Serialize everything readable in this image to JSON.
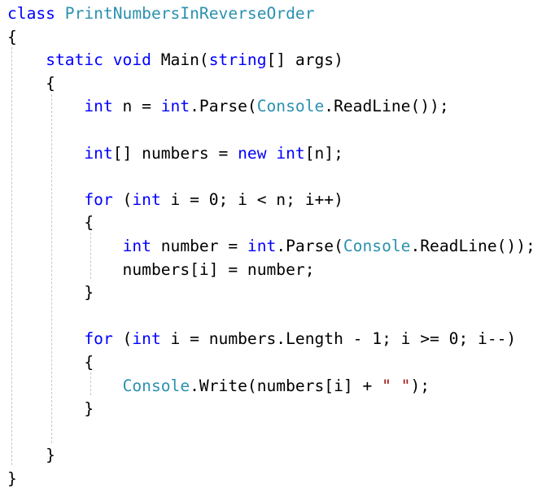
{
  "editor": {
    "colors": {
      "keyword": "#0000ff",
      "type": "#2b91af",
      "string": "#a31515",
      "plain": "#000000",
      "indent_guide": "#c8c8c8",
      "background": "#ffffff"
    },
    "lines": [
      [
        {
          "t": "class",
          "c": "kw"
        },
        {
          "t": " ",
          "c": "pl"
        },
        {
          "t": "PrintNumbersInReverseOrder",
          "c": "ty"
        }
      ],
      [
        {
          "t": "{",
          "c": "pl"
        }
      ],
      [
        {
          "t": "    ",
          "c": "pl"
        },
        {
          "t": "static",
          "c": "kw"
        },
        {
          "t": " ",
          "c": "pl"
        },
        {
          "t": "void",
          "c": "kw"
        },
        {
          "t": " Main(",
          "c": "pl"
        },
        {
          "t": "string",
          "c": "kw"
        },
        {
          "t": "[] args)",
          "c": "pl"
        }
      ],
      [
        {
          "t": "    {",
          "c": "pl"
        }
      ],
      [
        {
          "t": "        ",
          "c": "pl"
        },
        {
          "t": "int",
          "c": "kw"
        },
        {
          "t": " n = ",
          "c": "pl"
        },
        {
          "t": "int",
          "c": "kw"
        },
        {
          "t": ".Parse(",
          "c": "pl"
        },
        {
          "t": "Console",
          "c": "ty"
        },
        {
          "t": ".ReadLine());",
          "c": "pl"
        }
      ],
      [],
      [
        {
          "t": "        ",
          "c": "pl"
        },
        {
          "t": "int",
          "c": "kw"
        },
        {
          "t": "[] numbers = ",
          "c": "pl"
        },
        {
          "t": "new",
          "c": "kw"
        },
        {
          "t": " ",
          "c": "pl"
        },
        {
          "t": "int",
          "c": "kw"
        },
        {
          "t": "[n];",
          "c": "pl"
        }
      ],
      [],
      [
        {
          "t": "        ",
          "c": "pl"
        },
        {
          "t": "for",
          "c": "kw"
        },
        {
          "t": " (",
          "c": "pl"
        },
        {
          "t": "int",
          "c": "kw"
        },
        {
          "t": " i = 0; i < n; i++)",
          "c": "pl"
        }
      ],
      [
        {
          "t": "        {",
          "c": "pl"
        }
      ],
      [
        {
          "t": "            ",
          "c": "pl"
        },
        {
          "t": "int",
          "c": "kw"
        },
        {
          "t": " number = ",
          "c": "pl"
        },
        {
          "t": "int",
          "c": "kw"
        },
        {
          "t": ".Parse(",
          "c": "pl"
        },
        {
          "t": "Console",
          "c": "ty"
        },
        {
          "t": ".ReadLine());",
          "c": "pl"
        }
      ],
      [
        {
          "t": "            numbers[i] = number;",
          "c": "pl"
        }
      ],
      [
        {
          "t": "        }",
          "c": "pl"
        }
      ],
      [],
      [
        {
          "t": "        ",
          "c": "pl"
        },
        {
          "t": "for",
          "c": "kw"
        },
        {
          "t": " (",
          "c": "pl"
        },
        {
          "t": "int",
          "c": "kw"
        },
        {
          "t": " i = numbers.Length - 1; i >= 0; i--)",
          "c": "pl"
        }
      ],
      [
        {
          "t": "        {",
          "c": "pl"
        }
      ],
      [
        {
          "t": "            ",
          "c": "pl"
        },
        {
          "t": "Console",
          "c": "ty"
        },
        {
          "t": ".Write(numbers[i] + ",
          "c": "pl"
        },
        {
          "t": "\" \"",
          "c": "st"
        },
        {
          "t": ");",
          "c": "pl"
        }
      ],
      [
        {
          "t": "        }",
          "c": "pl"
        }
      ],
      [],
      [
        {
          "t": "    }",
          "c": "pl"
        }
      ],
      [
        {
          "t": "}",
          "c": "pl"
        }
      ]
    ]
  }
}
